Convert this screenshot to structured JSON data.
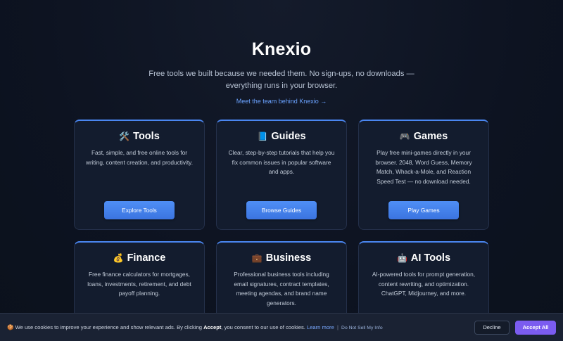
{
  "hero": {
    "brand": "Knexio",
    "tagline": "Free tools we built because we needed them. No sign-ups, no downloads — everything runs in your browser.",
    "team_link": "Meet the team behind Knexio →"
  },
  "cards": [
    {
      "icon": "🛠️",
      "icon_name": "hammer-wrench-icon",
      "title": "Tools",
      "description": "Fast, simple, and free online tools for writing, content creation, and productivity.",
      "button": "Explore Tools"
    },
    {
      "icon": "📘",
      "icon_name": "blue-book-icon",
      "title": "Guides",
      "description": "Clear, step-by-step tutorials that help you fix common issues in popular software and apps.",
      "button": "Browse Guides"
    },
    {
      "icon": "🎮",
      "icon_name": "game-controller-icon",
      "title": "Games",
      "description": "Play free mini-games directly in your browser. 2048, Word Guess, Memory Match, Whack-a-Mole, and Reaction Speed Test — no download needed.",
      "button": "Play Games"
    },
    {
      "icon": "💰",
      "icon_name": "money-bag-icon",
      "title": "Finance",
      "description": "Free finance calculators for mortgages, loans, investments, retirement, and debt payoff planning.",
      "button": ""
    },
    {
      "icon": "💼",
      "icon_name": "briefcase-icon",
      "title": "Business",
      "description": "Professional business tools including email signatures, contract templates, meeting agendas, and brand name generators.",
      "button": ""
    },
    {
      "icon": "🤖",
      "icon_name": "robot-icon",
      "title": "AI Tools",
      "description": "AI-powered tools for prompt generation, content rewriting, and optimization. ChatGPT, Midjourney, and more.",
      "button": ""
    }
  ],
  "cookie": {
    "icon": "🍪",
    "text_before": "We use cookies to improve your experience and show relevant ads. By clicking ",
    "accept_word": "Accept",
    "text_after": ", you consent to our use of cookies. ",
    "learn_more": "Learn more",
    "separator": "|",
    "do_not_sell": "Do Not Sell My Info",
    "decline": "Decline",
    "accept_all": "Accept All"
  },
  "colors": {
    "background": "#0d1321",
    "card": "#131c2e",
    "accent_blue": "#4a86f0",
    "accept_purple": "#7b5cf0"
  }
}
